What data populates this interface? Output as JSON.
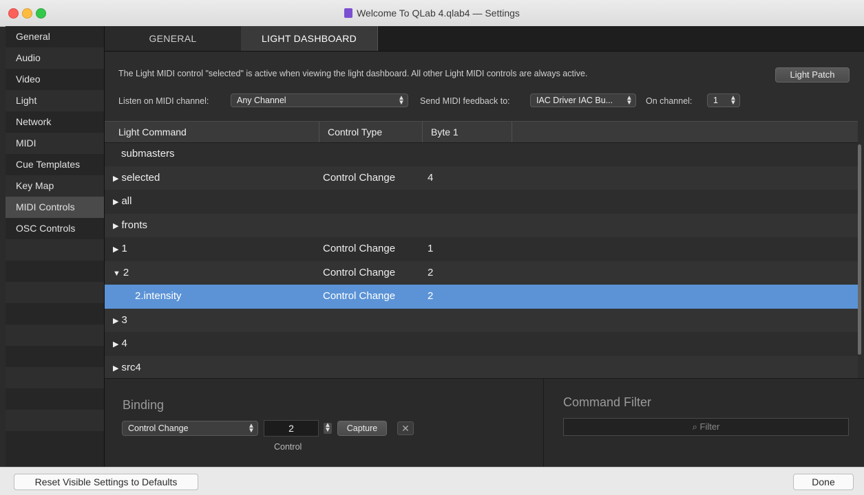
{
  "window": {
    "title": "Welcome To QLab 4.qlab4 — Settings"
  },
  "sidebar": {
    "items": [
      {
        "label": "General"
      },
      {
        "label": "Audio"
      },
      {
        "label": "Video"
      },
      {
        "label": "Light"
      },
      {
        "label": "Network"
      },
      {
        "label": "MIDI"
      },
      {
        "label": "Cue Templates"
      },
      {
        "label": "Key Map"
      },
      {
        "label": "MIDI Controls"
      },
      {
        "label": "OSC Controls"
      }
    ],
    "selected": "MIDI Controls"
  },
  "tabs": [
    {
      "label": "GENERAL"
    },
    {
      "label": "LIGHT DASHBOARD"
    }
  ],
  "info_text": "The Light MIDI control \"selected\" is active when viewing the light dashboard. All other Light MIDI controls are always active.",
  "light_patch_button": "Light Patch",
  "listen": {
    "label": "Listen on MIDI channel:",
    "value": "Any Channel"
  },
  "feedback": {
    "label": "Send MIDI feedback to:",
    "value": "IAC Driver IAC Bu...",
    "channel_label": "On channel:",
    "channel_value": "1"
  },
  "table": {
    "headers": [
      "Light Command",
      "Control Type",
      "Byte 1"
    ],
    "rows": [
      {
        "command": "submasters",
        "type": "",
        "byte": ""
      },
      {
        "command": "selected",
        "type": "Control Change",
        "byte": "4"
      },
      {
        "command": "all",
        "type": "",
        "byte": ""
      },
      {
        "command": "fronts",
        "type": "",
        "byte": ""
      },
      {
        "command": "1",
        "type": "Control Change",
        "byte": "1"
      },
      {
        "command": "2",
        "type": "Control Change",
        "byte": "2"
      },
      {
        "command": "2.intensity",
        "type": "Control Change",
        "byte": "2"
      },
      {
        "command": "3",
        "type": "",
        "byte": ""
      },
      {
        "command": "4",
        "type": "",
        "byte": ""
      },
      {
        "command": "src4",
        "type": "",
        "byte": ""
      }
    ]
  },
  "binding": {
    "title": "Binding",
    "type_value": "Control Change",
    "control_value": "2",
    "control_label": "Control",
    "capture_label": "Capture",
    "clear_glyph": "✕"
  },
  "command_filter": {
    "title": "Command Filter",
    "placeholder": "Filter"
  },
  "footer": {
    "reset_label": "Reset Visible Settings to Defaults",
    "done_label": "Done"
  },
  "colors": {
    "selection": "#5b93d6",
    "background": "#2b2b2b"
  }
}
